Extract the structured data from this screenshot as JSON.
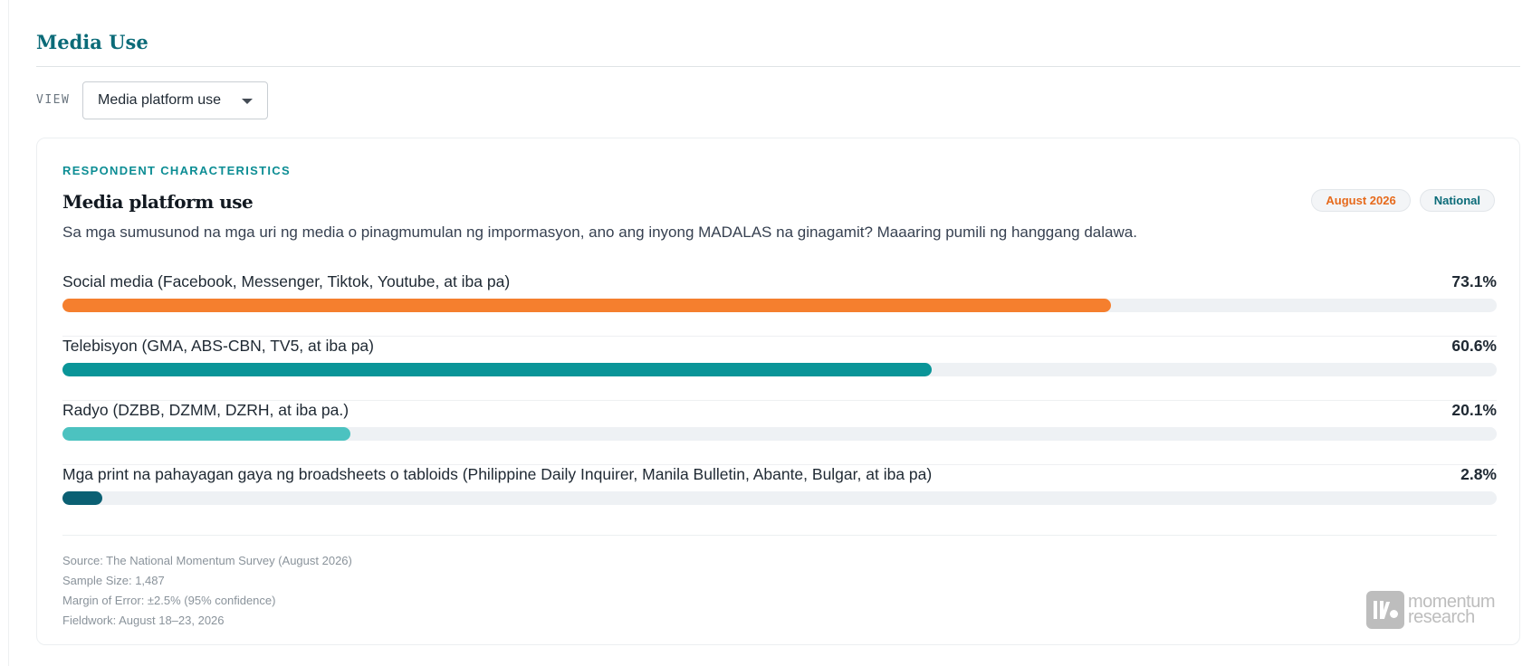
{
  "section": {
    "title": "Media Use"
  },
  "view": {
    "label": "VIEW",
    "selected": "Media platform use"
  },
  "card": {
    "eyebrow": "RESPONDENT CHARACTERISTICS",
    "title": "Media platform use",
    "badges": {
      "date": "August 2026",
      "scope": "National"
    },
    "question": "Sa mga sumusunod na mga uri ng media o pinagmumulan ng impormasyon, ano ang inyong MADALAS na ginagamit? Maaaring pumili ng hanggang dalawa."
  },
  "chart_data": {
    "type": "bar",
    "orientation": "horizontal",
    "title": "Media platform use",
    "unit": "%",
    "xlim": [
      0,
      100
    ],
    "categories": [
      "Social media (Facebook, Messenger, Tiktok, Youtube, at iba pa)",
      "Telebisyon (GMA, ABS-CBN, TV5, at iba pa)",
      "Radyo (DZBB, DZMM, DZRH, at iba pa.)",
      "Mga print na pahayagan gaya ng broadsheets o tabloids (Philippine Daily Inquirer, Manila Bulletin, Abante, Bulgar, at iba pa)"
    ],
    "values": [
      73.1,
      60.6,
      20.1,
      2.8
    ],
    "value_labels": [
      "73.1%",
      "60.6%",
      "20.1%",
      "2.8%"
    ],
    "colors": [
      "#f57f2e",
      "#0a9598",
      "#4cc2c0",
      "#0b6073"
    ],
    "track_color": "#eef1f4"
  },
  "footer": {
    "source": "Source: The National Momentum Survey (August 2026)",
    "sample": "Sample Size: 1,487",
    "margin": "Margin of Error: ±2.5% (95% confidence)",
    "fieldwork": "Fieldwork: August 18–23, 2026"
  },
  "logo": {
    "line1": "momentum",
    "line2": "research"
  }
}
